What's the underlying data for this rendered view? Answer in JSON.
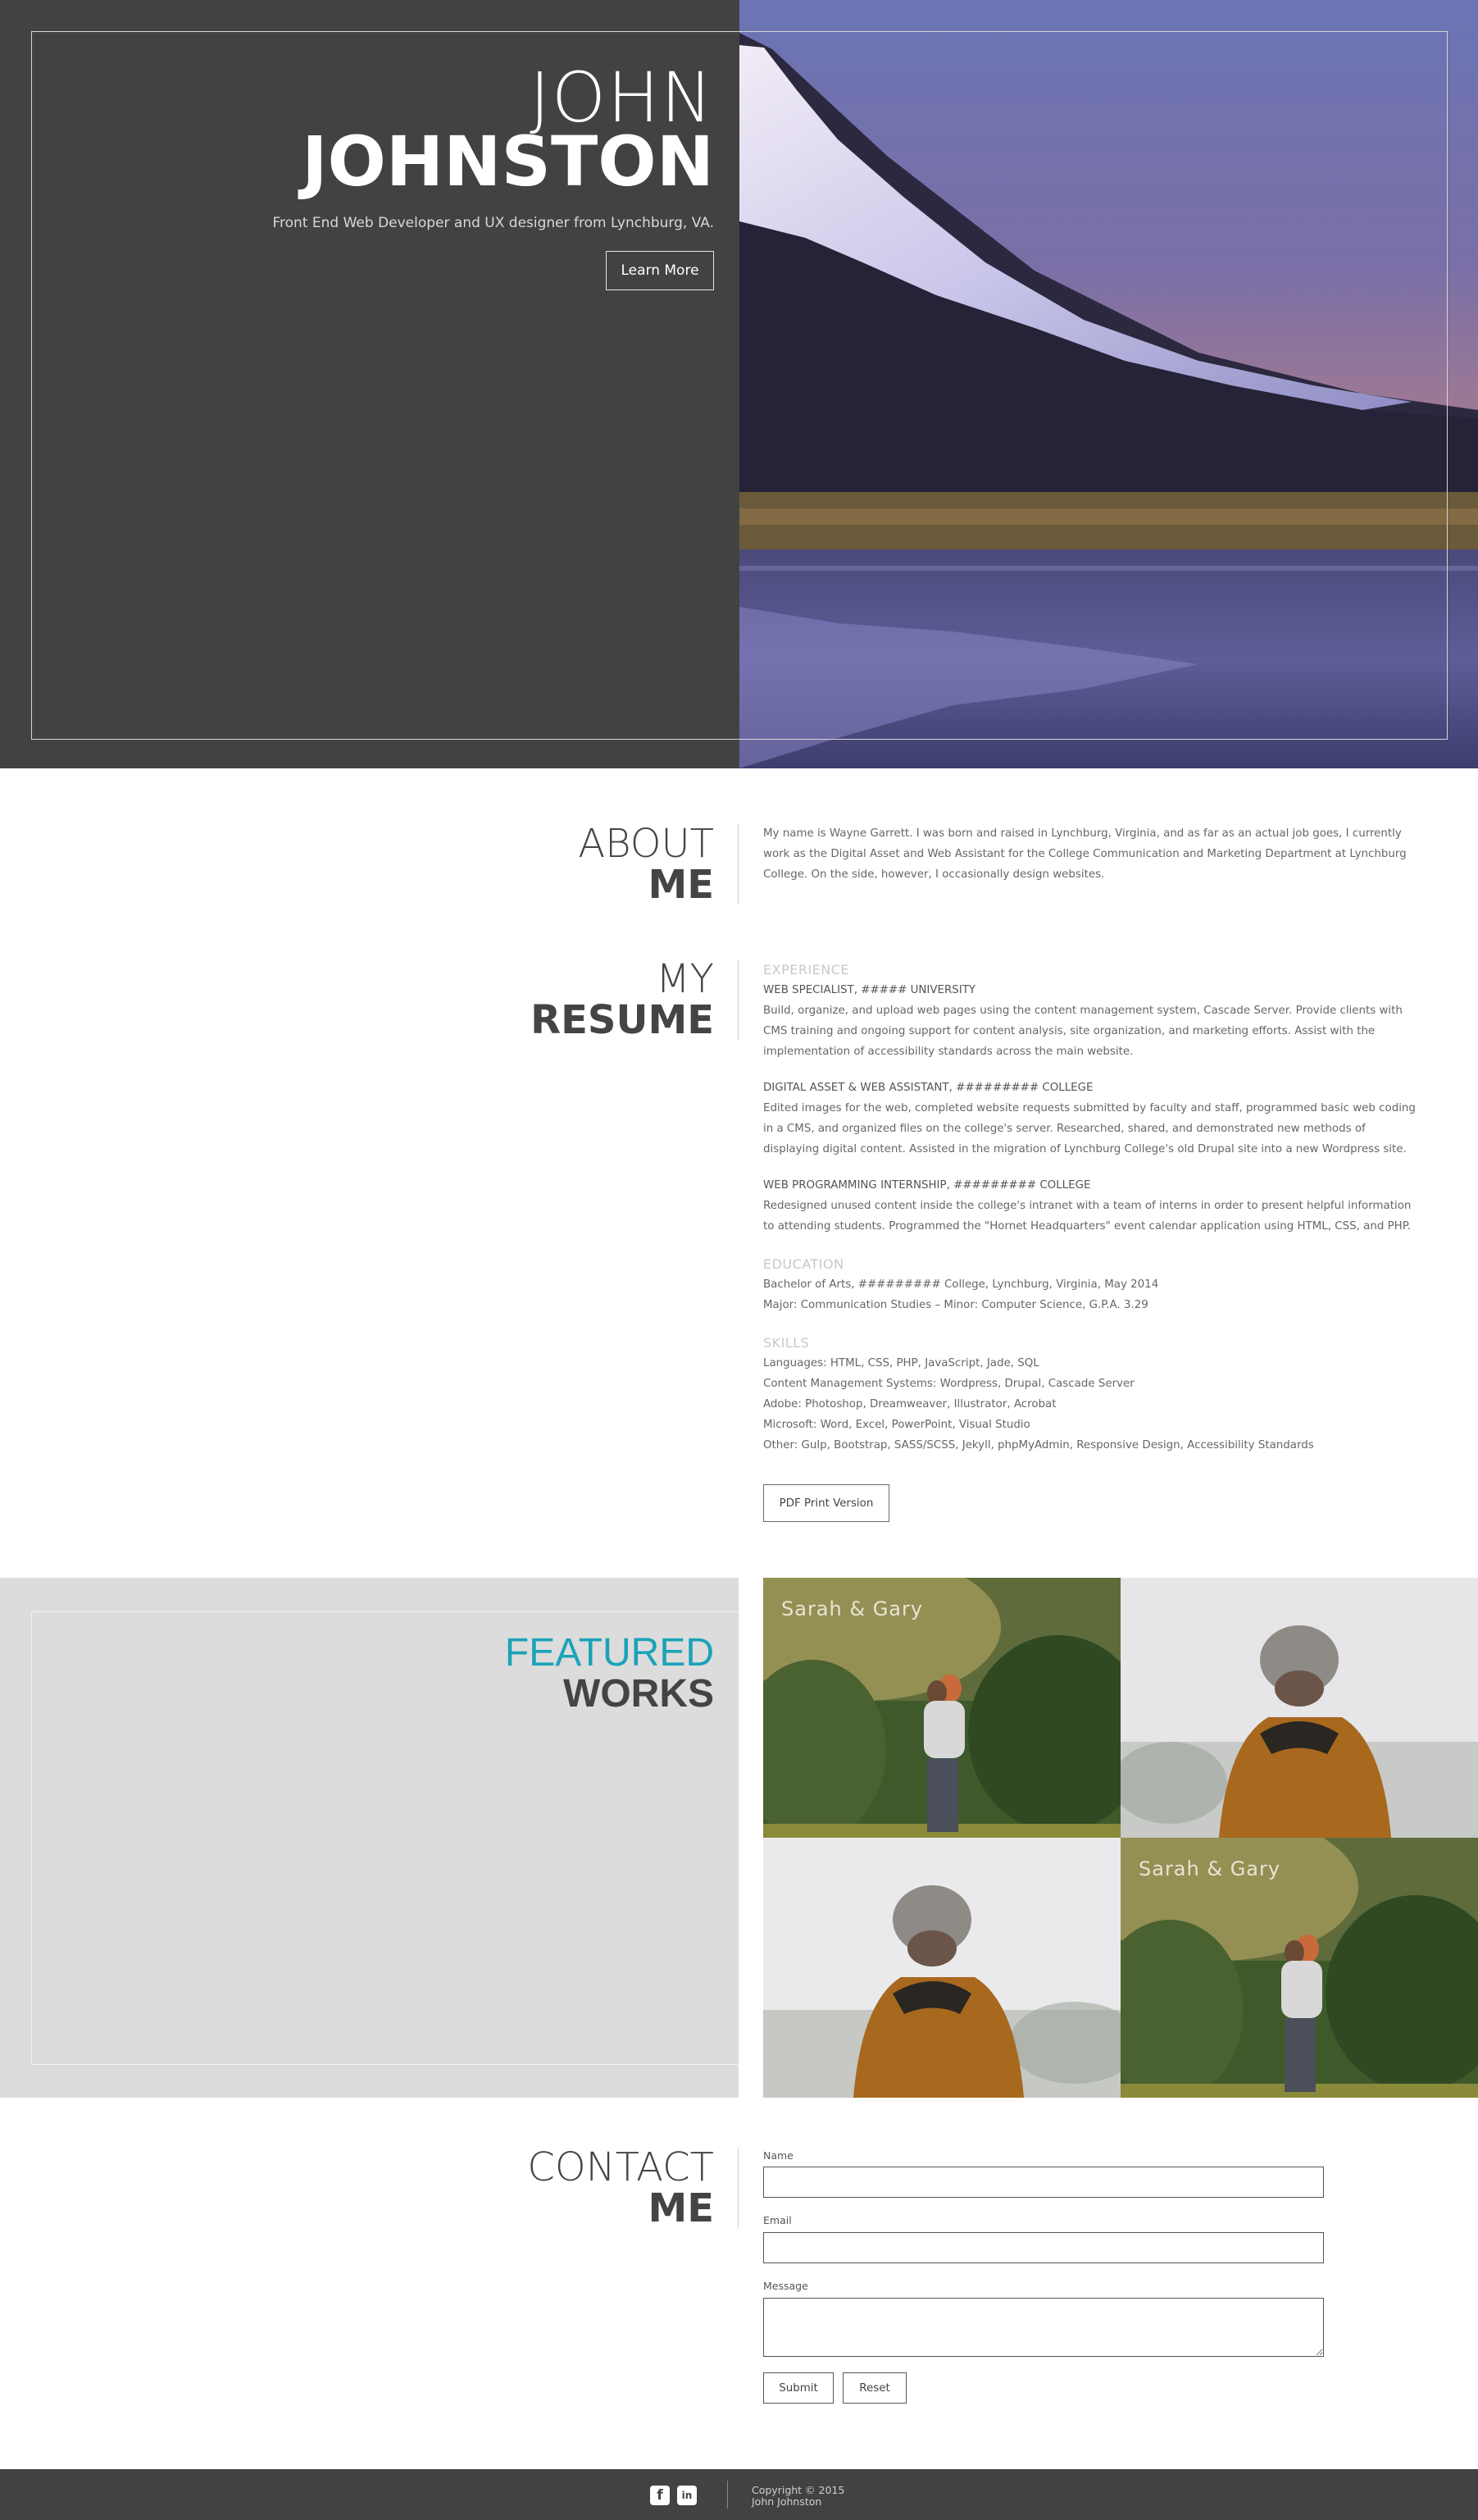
{
  "hero": {
    "first_name": "JOHN",
    "last_name": "JOHNSTON",
    "tagline": "Front End Web Developer and UX designer from Lynchburg, VA.",
    "button_label": "Learn More"
  },
  "about": {
    "heading_light": "ABOUT",
    "heading_bold": "ME",
    "text": "My name is Wayne Garrett. I was born and raised in Lynchburg, Virginia, and as far as an actual job goes, I currently work as the Digital Asset and Web Assistant for the College Communication and Marketing Department at Lynchburg College. On the side, however, I occasionally design websites."
  },
  "resume": {
    "heading_light": "MY",
    "heading_bold": "RESUME",
    "experience_label": "EXPERIENCE",
    "jobs": [
      {
        "title": "WEB SPECIALIST, ##### UNIVERSITY",
        "description": "Build, organize, and upload web pages using the content management system, Cascade Server. Provide clients with CMS training and ongoing support for content analysis, site organization, and marketing efforts. Assist with the implementation of accessibility standards across the main website."
      },
      {
        "title": "DIGITAL ASSET & WEB ASSISTANT, ######### COLLEGE",
        "description": "Edited images for the web, completed website requests submitted by faculty and staff, programmed basic web coding in a CMS, and organized files on the college's server. Researched, shared, and demonstrated new methods of displaying digital content. Assisted in the migration of Lynchburg College's old Drupal site into a new Wordpress site."
      },
      {
        "title": "WEB PROGRAMMING INTERNSHIP, ######### COLLEGE",
        "description": "Redesigned unused content inside the college's intranet with a team of interns in order to present helpful information to attending students. Programmed the \"Hornet Headquarters\" event calendar application using HTML, CSS, and PHP."
      }
    ],
    "education_label": "EDUCATION",
    "education": [
      "Bachelor of Arts, ######### College, Lynchburg, Virginia, May 2014",
      "Major: Communication Studies – Minor: Computer Science, G.P.A. 3.29"
    ],
    "skills_label": "SKILLS",
    "skills": [
      "Languages: HTML, CSS, PHP, JavaScript, Jade, SQL",
      "Content Management Systems: Wordpress, Drupal, Cascade Server",
      "Adobe: Photoshop, Dreamweaver, Illustrator, Acrobat",
      "Microsoft: Word, Excel, PowerPoint, Visual Studio",
      "Other: Gulp, Bootstrap, SASS/SCSS, Jekyll, phpMyAdmin, Responsive Design, Accessibility Standards"
    ],
    "pdf_button": "PDF Print Version"
  },
  "featured": {
    "heading_light": "FEATURED",
    "heading_bold": "WORKS",
    "tile_1_caption": "Sarah & Gary",
    "tile_4_caption": "Sarah & Gary"
  },
  "contact": {
    "heading_light": "CONTACT",
    "heading_bold": "ME",
    "name_label": "Name",
    "email_label": "Email",
    "message_label": "Message",
    "submit_label": "Submit",
    "reset_label": "Reset"
  },
  "footer": {
    "facebook_glyph": "f",
    "linkedin_glyph": "in",
    "copyright": "Copyright © 2015",
    "name": "John Johnston"
  },
  "colors": {
    "dark": "#424242",
    "accent": "#1aa3b8",
    "featured_bg": "#dcdcdc"
  },
  "icons": [
    "facebook-icon",
    "linkedin-icon"
  ]
}
